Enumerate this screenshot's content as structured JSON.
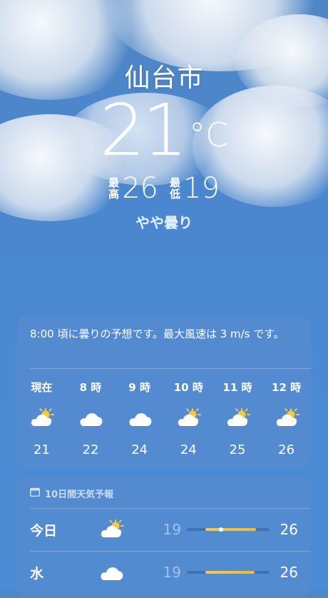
{
  "location": {
    "city": "仙台市",
    "temperature": "21",
    "unit": "°C",
    "high_label": [
      "最",
      "高"
    ],
    "high": "26",
    "low_label": [
      "最",
      "低"
    ],
    "low": "19",
    "condition": "やや曇り"
  },
  "hourly": {
    "summary": "8:00 頃に曇りの予想です。最大風速は 3 m/s です。",
    "items": [
      {
        "time": "現在",
        "icon": "partly-sunny-icon",
        "temp": "21"
      },
      {
        "time": "8 時",
        "icon": "cloud-icon",
        "temp": "22"
      },
      {
        "time": "9 時",
        "icon": "cloud-icon",
        "temp": "24"
      },
      {
        "time": "10 時",
        "icon": "partly-sunny-icon",
        "temp": "24"
      },
      {
        "time": "11 時",
        "icon": "partly-sunny-icon",
        "temp": "25"
      },
      {
        "time": "12 時",
        "icon": "partly-sunny-icon",
        "temp": "26"
      }
    ]
  },
  "daily": {
    "header": "10日間天気予報",
    "header_icon": "calendar-icon",
    "days": [
      {
        "name": "今日",
        "icon": "partly-sunny-icon",
        "low": "19",
        "high": "26",
        "bar_start": 0.22,
        "bar_end": 0.84,
        "current": 0.41
      },
      {
        "name": "水",
        "icon": "cloud-icon",
        "low": "19",
        "high": "26",
        "bar_start": 0.22,
        "bar_end": 0.82
      }
    ]
  },
  "colors": {
    "sky": "#4a87cf",
    "card": "#588ace",
    "bar": "#f3b73a",
    "low_temp": "#9fc3ef"
  }
}
